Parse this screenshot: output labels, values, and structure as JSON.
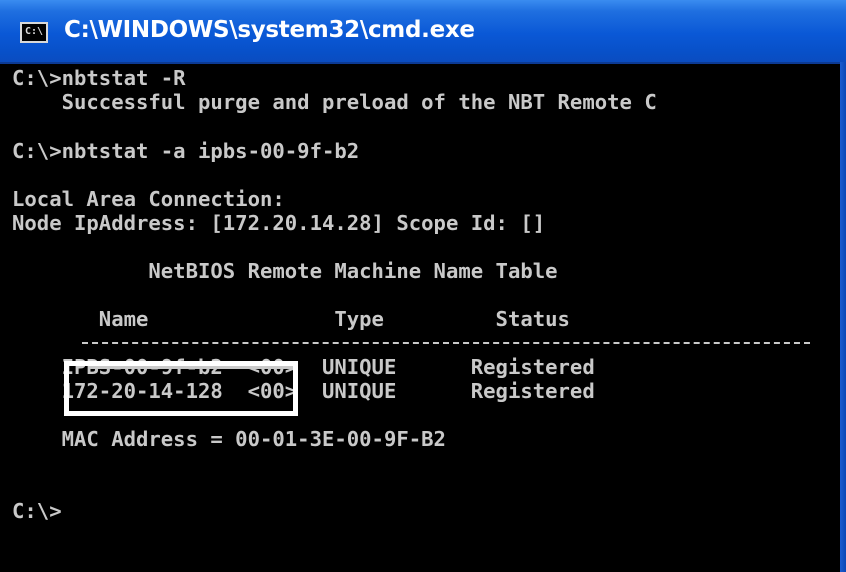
{
  "window": {
    "title": "C:\\WINDOWS\\system32\\cmd.exe",
    "icon_label": "C:\\"
  },
  "console": {
    "lines": [
      "C:\\>nbtstat -R",
      "    Successful purge and preload of the NBT Remote C",
      "C:\\>nbtstat -a ipbs-00-9f-b2",
      "Local Area Connection:",
      "Node IpAddress: [172.20.14.28] Scope Id: []",
      "           NetBIOS Remote Machine Name Table",
      "       Name               Type         Status",
      "    IPBS-00-9f-b2  <00>  UNIQUE      Registered",
      "    172-20-14-128  <00>  UNIQUE      Registered",
      "    MAC Address = 00-01-3E-00-9F-B2",
      "C:\\>"
    ]
  },
  "annotation": {
    "highlighted_text": "172-20-14-128"
  },
  "colors": {
    "console_bg": "#000000",
    "console_text": "#c9c9c9",
    "titlebar": "#0a58d6",
    "highlight_border": "#ffffff"
  }
}
